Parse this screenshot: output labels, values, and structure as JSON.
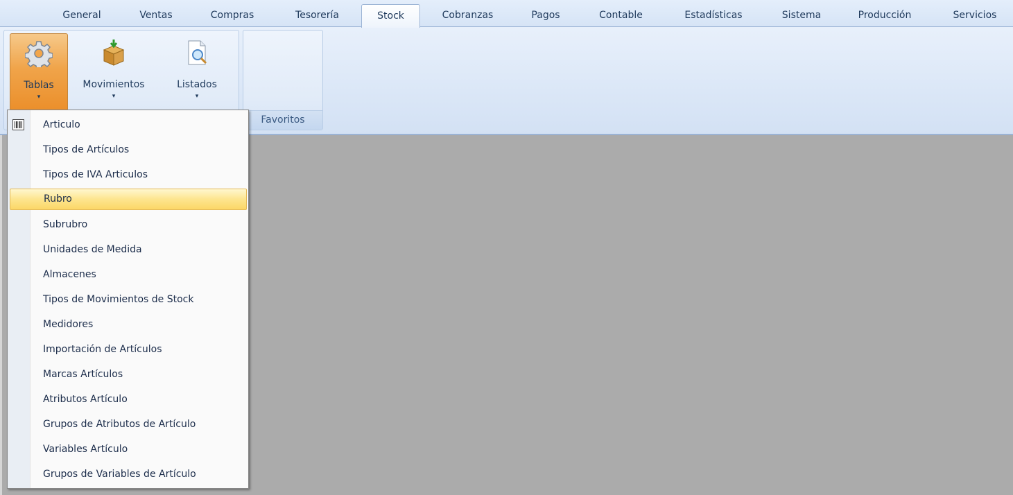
{
  "tabs": [
    {
      "label": "General"
    },
    {
      "label": "Ventas"
    },
    {
      "label": "Compras"
    },
    {
      "label": "Tesorería"
    },
    {
      "label": "Stock",
      "active": true
    },
    {
      "label": "Cobranzas"
    },
    {
      "label": "Pagos"
    },
    {
      "label": "Contable"
    },
    {
      "label": "Estadísticas"
    },
    {
      "label": "Sistema"
    },
    {
      "label": "Producción"
    },
    {
      "label": "Servicios"
    }
  ],
  "ribbon": {
    "buttons": [
      {
        "label": "Tablas",
        "icon": "gear-icon",
        "arrow": "▾",
        "pressed": true
      },
      {
        "label": "Movimientos",
        "icon": "box-icon",
        "arrow": "▾"
      },
      {
        "label": "Listados",
        "icon": "document-search-icon",
        "arrow": "▾"
      }
    ],
    "favorites_caption": "Favoritos"
  },
  "menu": {
    "items": [
      {
        "label": "Articulo",
        "icon": "barcode-icon"
      },
      {
        "label": "Tipos de Artículos"
      },
      {
        "label": "Tipos de IVA Articulos"
      },
      {
        "label": "Rubro",
        "highlighted": true
      },
      {
        "label": "Subrubro"
      },
      {
        "label": "Unidades de Medida"
      },
      {
        "label": "Almacenes"
      },
      {
        "label": "Tipos de Movimientos de Stock"
      },
      {
        "label": "Medidores"
      },
      {
        "label": "Importación de Artículos"
      },
      {
        "label": "Marcas Artículos"
      },
      {
        "label": "Atributos Artículo"
      },
      {
        "label": "Grupos de Atributos de Artículo"
      },
      {
        "label": "Variables Artículo"
      },
      {
        "label": "Grupos de Variables de Artículo"
      }
    ]
  },
  "colors": {
    "workspace": "#ababab",
    "highlight": "#fde58e",
    "pressed": "#f0a44a"
  }
}
